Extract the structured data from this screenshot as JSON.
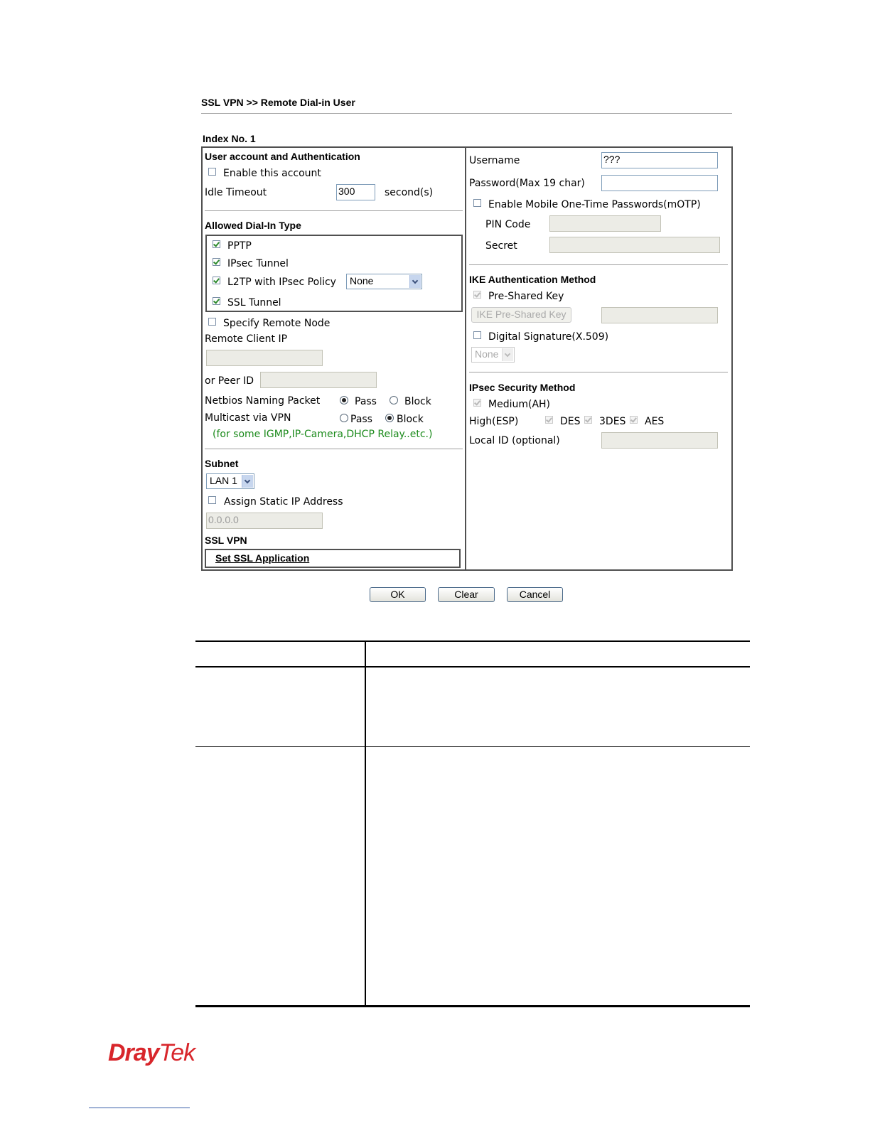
{
  "header": {
    "breadcrumb": "SSL VPN >> Remote Dial-in User",
    "index_label": "Index No. 1"
  },
  "left": {
    "section_user": "User account and Authentication",
    "enable_account": {
      "label": "Enable this account",
      "checked": false
    },
    "idle_timeout": {
      "label": "Idle Timeout",
      "value": "300",
      "unit": "second(s)"
    },
    "section_dialin": "Allowed Dial-In Type",
    "dialin_types": [
      {
        "label": "PPTP",
        "checked": true
      },
      {
        "label": "IPsec Tunnel",
        "checked": true
      },
      {
        "label": "L2TP with IPsec Policy",
        "checked": true
      },
      {
        "label": "SSL Tunnel",
        "checked": true
      }
    ],
    "l2tp_policy_select": "None",
    "specify_remote_node": {
      "label": "Specify Remote Node",
      "checked": false
    },
    "remote_client_ip_label": "Remote Client IP",
    "remote_client_ip_value": "",
    "peer_id_label": "or Peer ID",
    "peer_id_value": "",
    "netbios": {
      "label": "Netbios Naming Packet",
      "pass": "Pass",
      "block": "Block",
      "selected": "Pass"
    },
    "multicast": {
      "label": "Multicast via VPN",
      "pass": "Pass",
      "block": "Block",
      "selected": "Block"
    },
    "multicast_note": "(for some IGMP,IP-Camera,DHCP Relay..etc.)",
    "section_subnet": "Subnet",
    "subnet_select": "LAN 1",
    "assign_static": {
      "label": "Assign Static IP Address",
      "checked": false
    },
    "static_ip_value": "0.0.0.0",
    "section_sslvpn": "SSL VPN",
    "set_ssl_application": "Set SSL Application"
  },
  "right": {
    "username_label": "Username",
    "username_value": "???",
    "password_label": "Password(Max 19 char)",
    "password_value": "",
    "motp": {
      "label": "Enable Mobile One-Time Passwords(mOTP)",
      "checked": false
    },
    "pin_code_label": "PIN Code",
    "secret_label": "Secret",
    "section_ike": "IKE Authentication Method",
    "pre_shared_key": {
      "label": "Pre-Shared Key",
      "checked": true
    },
    "ike_psk_button": "IKE Pre-Shared Key",
    "digital_signature": {
      "label": "Digital Signature(X.509)",
      "checked": false
    },
    "x509_select": "None",
    "section_ipsec": "IPsec Security Method",
    "medium_ah": {
      "label": "Medium(AH)",
      "checked": true
    },
    "high_esp_label": "High(ESP)",
    "des_label": "DES",
    "des3_label": "3DES",
    "aes_label": "AES",
    "local_id_label": "Local ID (optional)"
  },
  "buttons": {
    "ok": "OK",
    "clear": "Clear",
    "cancel": "Cancel"
  },
  "logo": {
    "text_dray": "Dray",
    "text_tek": "Tek",
    "color": "#d8262b"
  }
}
